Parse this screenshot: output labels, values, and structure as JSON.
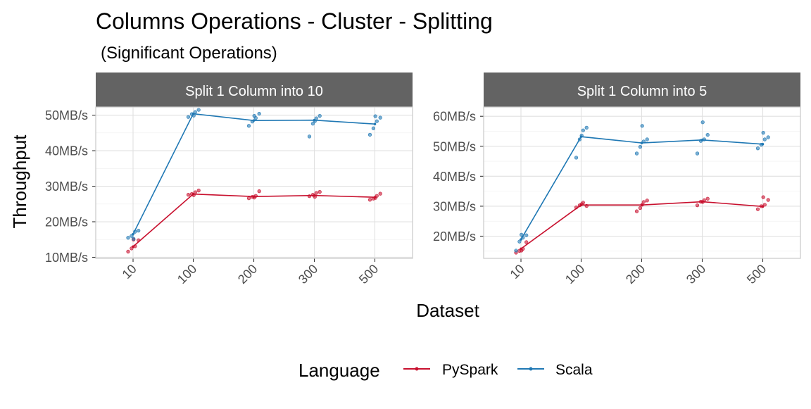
{
  "chart_data": {
    "type": "line",
    "title": "Columns Operations - Cluster - Splitting",
    "subtitle": "(Significant Operations)",
    "xlabel": "Dataset",
    "ylabel": "Throughput",
    "categories": [
      "10",
      "100",
      "200",
      "300",
      "500"
    ],
    "legend": {
      "title": "Language",
      "position": "bottom",
      "items": [
        {
          "name": "PySpark",
          "color": "#c8102e"
        },
        {
          "name": "Scala",
          "color": "#1f78b4"
        }
      ]
    },
    "grid": true,
    "panels": [
      {
        "strip": "Split 1 Column into 10",
        "ylim": [
          9.7,
          52.3
        ],
        "yticks": [
          10,
          20,
          30,
          40,
          50
        ],
        "ytick_labels": [
          "10MB/s",
          "20MB/s",
          "30MB/s",
          "40MB/s",
          "50MB/s"
        ],
        "series": [
          {
            "name": "PySpark",
            "mean": [
              13.0,
              27.8,
              27.1,
              27.4,
              26.9
            ],
            "points": [
              [
                11.6,
                12.5,
                13.1,
                14.8,
                15.0
              ],
              [
                27.6,
                27.8,
                28.3,
                28.8,
                27.5
              ],
              [
                26.6,
                27.0,
                27.3,
                28.6,
                26.8
              ],
              [
                27.2,
                27.6,
                28.1,
                28.4,
                27.0
              ],
              [
                26.2,
                26.5,
                27.3,
                27.9,
                26.7
              ]
            ]
          },
          {
            "name": "Scala",
            "mean": [
              16.5,
              50.4,
              48.5,
              48.6,
              47.5
            ],
            "points": [
              [
                15.5,
                16.0,
                17.2,
                17.5,
                15.2
              ],
              [
                49.5,
                50.3,
                50.9,
                51.5,
                49.9
              ],
              [
                47.0,
                48.2,
                49.2,
                50.4,
                49.8
              ],
              [
                44.0,
                47.6,
                49.1,
                49.8,
                48.3
              ],
              [
                44.5,
                46.3,
                48.3,
                49.3,
                49.7
              ]
            ]
          }
        ]
      },
      {
        "strip": "Split 1 Column into 5",
        "ylim": [
          12.6,
          63.1
        ],
        "yticks": [
          20,
          30,
          40,
          50,
          60
        ],
        "ytick_labels": [
          "20MB/s",
          "30MB/s",
          "40MB/s",
          "50MB/s",
          "60MB/s"
        ],
        "series": [
          {
            "name": "PySpark",
            "mean": [
              15.8,
              30.4,
              30.4,
              31.5,
              29.9
            ],
            "points": [
              [
                14.5,
                15.1,
                15.8,
                18.0,
                15.2
              ],
              [
                29.6,
                30.3,
                31.2,
                30.1,
                30.7
              ],
              [
                28.3,
                29.4,
                31.4,
                31.9,
                30.5
              ],
              [
                30.3,
                31.5,
                32.0,
                32.5,
                31.4
              ],
              [
                29.0,
                30.0,
                30.5,
                32.1,
                33.0
              ]
            ]
          },
          {
            "name": "Scala",
            "mean": [
              18.9,
              53.2,
              51.1,
              52.1,
              50.7
            ],
            "points": [
              [
                15.2,
                18.2,
                19.5,
                20.3,
                20.5
              ],
              [
                46.2,
                52.3,
                55.3,
                56.2,
                53.6
              ],
              [
                47.6,
                49.8,
                51.6,
                52.3,
                56.8
              ],
              [
                47.6,
                51.8,
                52.3,
                53.8,
                58.0
              ],
              [
                49.3,
                50.5,
                52.3,
                53.0,
                54.5
              ]
            ]
          }
        ]
      }
    ]
  }
}
